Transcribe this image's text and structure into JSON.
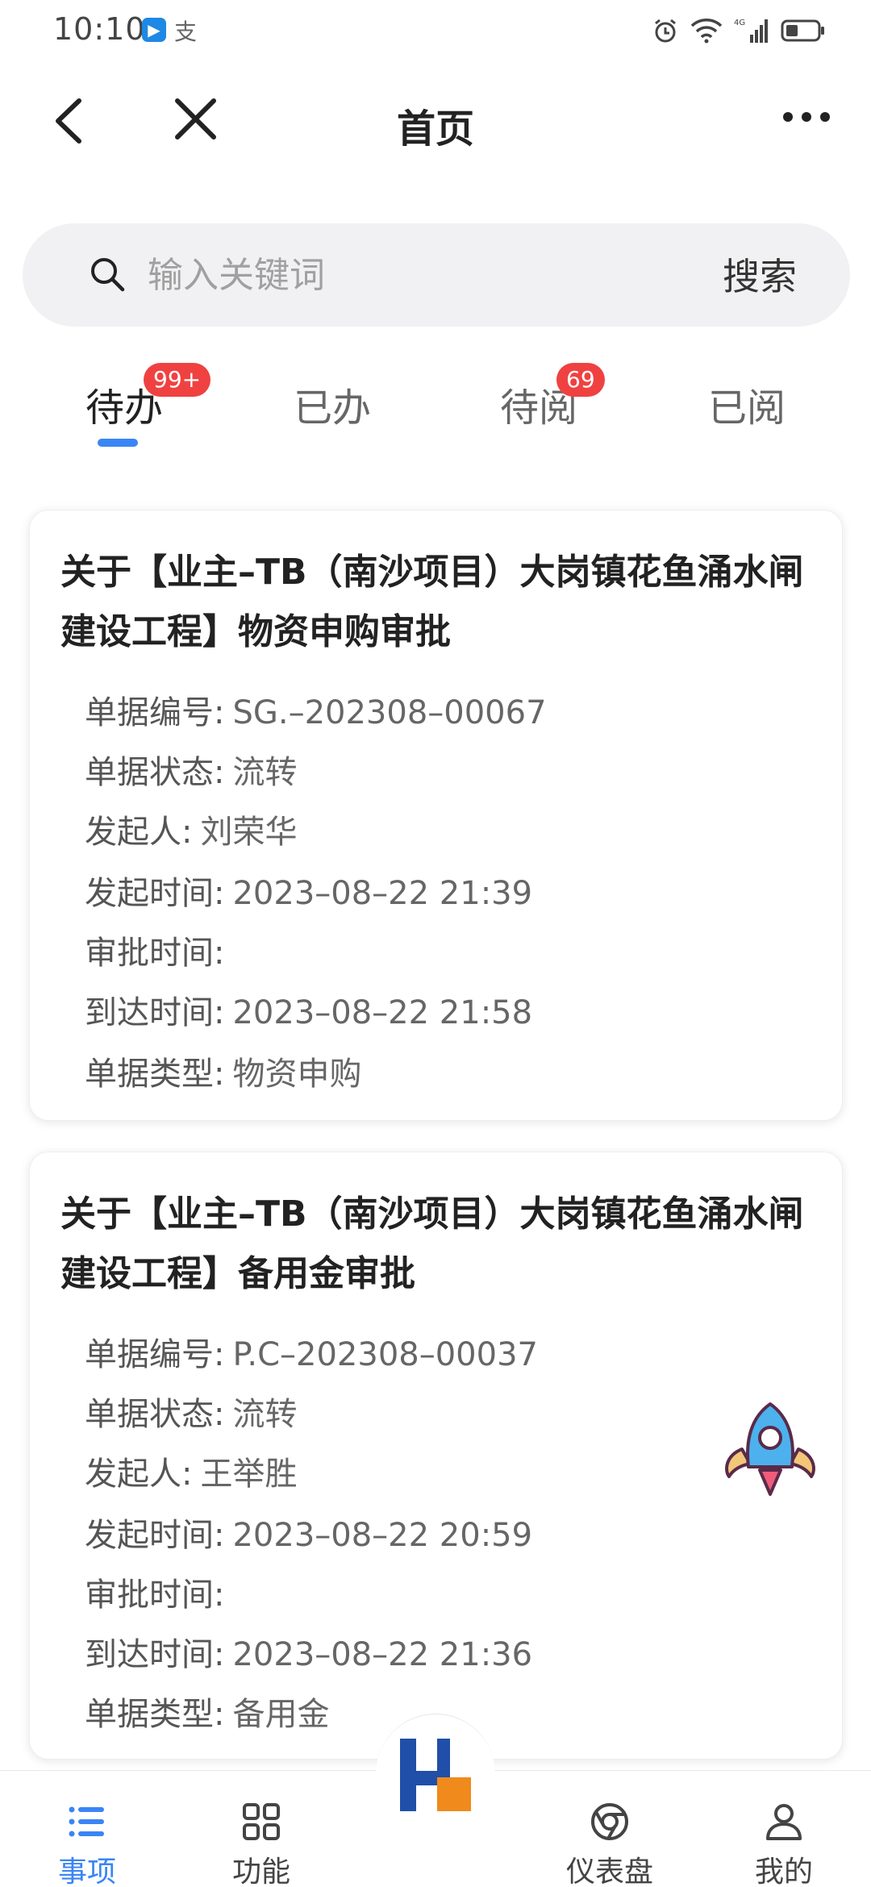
{
  "status_bar": {
    "time": "10:10",
    "app_icon_1": "app-notification-icon",
    "app_icon_2_text": "支",
    "right_icons": [
      "alarm-icon",
      "wifi-icon",
      "signal-4g-icon",
      "battery-icon"
    ]
  },
  "nav": {
    "title": "首页",
    "back_icon": "back-icon",
    "close_icon": "close-icon",
    "more_icon": "more-icon"
  },
  "search": {
    "placeholder": "输入关键词",
    "button_label": "搜索"
  },
  "tabs": [
    {
      "label": "待办",
      "badge": "99+",
      "active": true
    },
    {
      "label": "已办",
      "badge": "",
      "active": false
    },
    {
      "label": "待阅",
      "badge": "69",
      "active": false
    },
    {
      "label": "已阅",
      "badge": "",
      "active": false
    }
  ],
  "cards": [
    {
      "title": "关于【业主–TB（南沙项目）大岗镇花鱼涌水闸建设工程】物资申购审批",
      "fields": [
        {
          "label": "单据编号:",
          "value": "SG.–202308–00067"
        },
        {
          "label": "单据状态:",
          "value": "流转"
        },
        {
          "label": "发起人:",
          "value": "刘荣华"
        },
        {
          "label": "发起时间:",
          "value": "2023–08–22 21:39"
        },
        {
          "label": "审批时间:",
          "value": ""
        },
        {
          "label": "到达时间:",
          "value": "2023–08–22 21:58"
        },
        {
          "label": "单据类型:",
          "value": "物资申购"
        }
      ]
    },
    {
      "title": "关于【业主–TB（南沙项目）大岗镇花鱼涌水闸建设工程】备用金审批",
      "fields": [
        {
          "label": "单据编号:",
          "value": "P.C–202308–00037"
        },
        {
          "label": "单据状态:",
          "value": "流转"
        },
        {
          "label": "发起人:",
          "value": "王举胜"
        },
        {
          "label": "发起时间:",
          "value": "2023–08–22 20:59"
        },
        {
          "label": "审批时间:",
          "value": ""
        },
        {
          "label": "到达时间:",
          "value": "2023–08–22 21:36"
        },
        {
          "label": "单据类型:",
          "value": "备用金"
        }
      ]
    }
  ],
  "bottom_nav": [
    {
      "label": "事项",
      "icon": "list-icon",
      "active": true
    },
    {
      "label": "功能",
      "icon": "grid-icon",
      "active": false
    },
    {
      "label": "",
      "icon": "home-logo-icon",
      "active": false
    },
    {
      "label": "仪表盘",
      "icon": "dashboard-icon",
      "active": false
    },
    {
      "label": "我的",
      "icon": "profile-icon",
      "active": false
    }
  ],
  "colors": {
    "accent": "#3a85f5",
    "badge": "#f04141",
    "logo_blue": "#1f4fa8",
    "logo_orange": "#f08a1c"
  }
}
